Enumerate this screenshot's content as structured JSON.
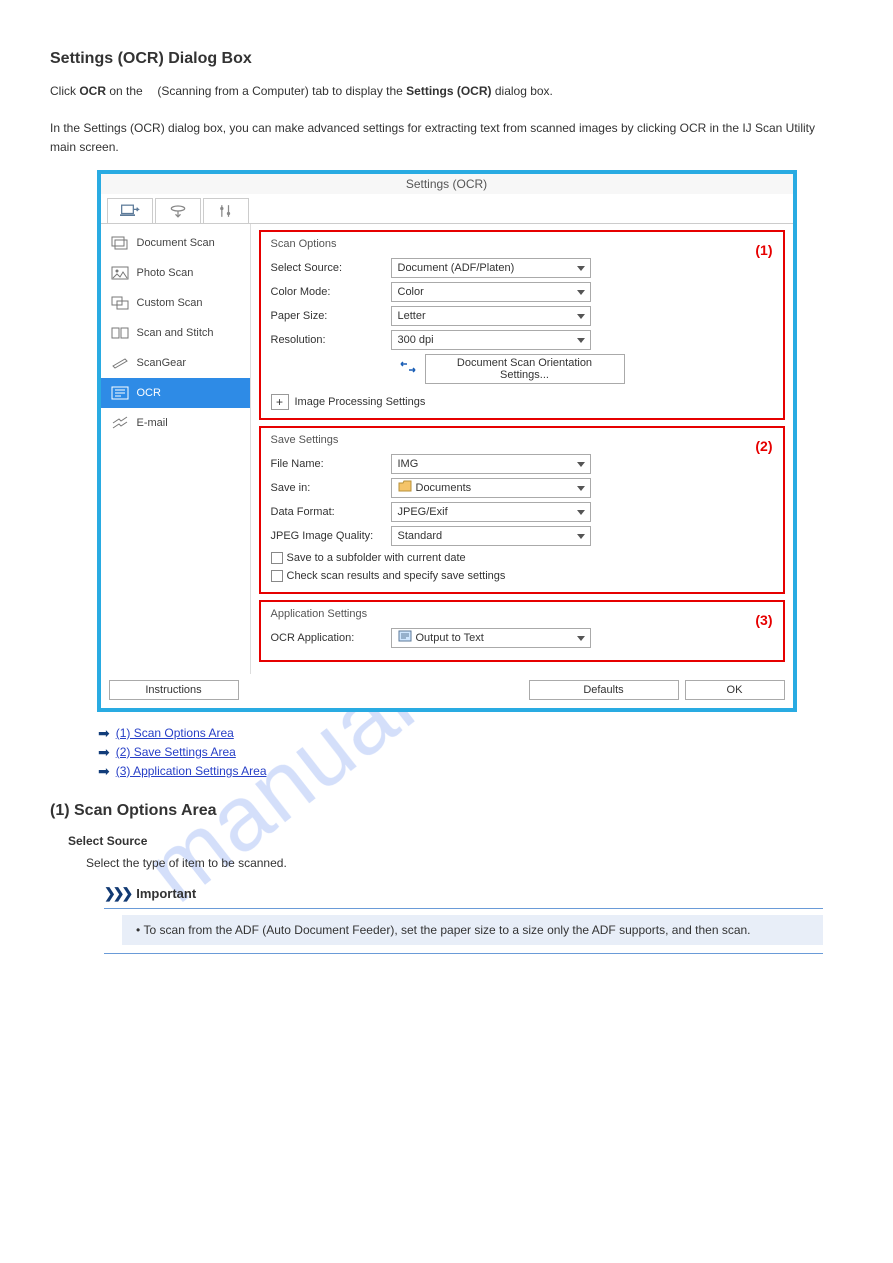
{
  "watermark": "manualshive.com",
  "heading_main": "Settings (OCR) Dialog Box",
  "intro1": "Click OCR on the  (Scanning from a Computer) tab to display the Settings (OCR) dialog box.",
  "intro2": "In the Settings (OCR) dialog box, you can make advanced settings for extracting text from scanned images by clicking OCR in the IJ Scan Utility main screen.",
  "dialog": {
    "title": "Settings (OCR)",
    "sidebar": {
      "items": [
        {
          "label": "Document Scan"
        },
        {
          "label": "Photo Scan"
        },
        {
          "label": "Custom Scan"
        },
        {
          "label": "Scan and Stitch"
        },
        {
          "label": "ScanGear"
        },
        {
          "label": "OCR"
        },
        {
          "label": "E-mail"
        }
      ]
    },
    "group1": {
      "legend": "Scan Options",
      "callout": "(1)",
      "select_source_label": "Select Source:",
      "select_source_value": "Document (ADF/Platen)",
      "color_mode_label": "Color Mode:",
      "color_mode_value": "Color",
      "paper_size_label": "Paper Size:",
      "paper_size_value": "Letter",
      "resolution_label": "Resolution:",
      "resolution_value": "300 dpi",
      "orientation_btn": "Document Scan Orientation Settings...",
      "imgproc": "Image Processing Settings"
    },
    "group2": {
      "legend": "Save Settings",
      "callout": "(2)",
      "filename_label": "File Name:",
      "filename_value": "IMG",
      "savein_label": "Save in:",
      "savein_value": "Documents",
      "dataformat_label": "Data Format:",
      "dataformat_value": "JPEG/Exif",
      "jpeg_label": "JPEG Image Quality:",
      "jpeg_value": "Standard",
      "chk1": "Save to a subfolder with current date",
      "chk2": "Check scan results and specify save settings"
    },
    "group3": {
      "legend": "Application Settings",
      "callout": "(3)",
      "ocr_app_label": "OCR Application:",
      "ocr_app_value": "Output to Text"
    },
    "instructions_btn": "Instructions",
    "defaults_btn": "Defaults",
    "ok_btn": "OK"
  },
  "arrows": {
    "a1": "(1) Scan Options Area",
    "a2": "(2) Save Settings Area",
    "a3": "(3) Application Settings Area"
  },
  "sec_heading": "(1) Scan Options Area",
  "sel_src_h": "Select Source",
  "sel_src_p": "Select the type of item to be scanned.",
  "important": "Important",
  "note_text": "To scan from the ADF (Auto Document Feeder), set the paper size to a size only the ADF supports, and then scan."
}
